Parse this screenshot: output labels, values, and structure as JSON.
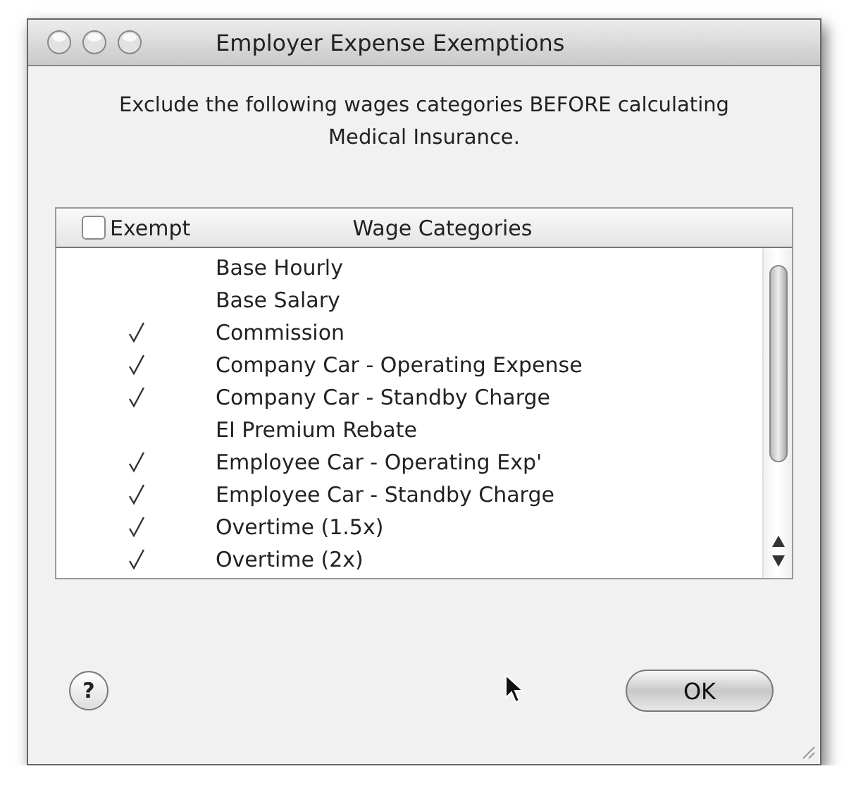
{
  "window": {
    "title": "Employer Expense Exemptions"
  },
  "message": "Exclude the following wages categories BEFORE calculating Medical Insurance.",
  "table": {
    "columns": [
      {
        "label": "Exempt",
        "kind": "checkbox",
        "checked": false
      },
      {
        "label": "Wage Categories",
        "kind": "text"
      }
    ],
    "rows": [
      {
        "name": "Base Hourly",
        "checked": false
      },
      {
        "name": "Base Salary",
        "checked": false
      },
      {
        "name": "Commission",
        "checked": true
      },
      {
        "name": "Company Car - Operating Expense",
        "checked": true
      },
      {
        "name": "Company Car - Standby Charge",
        "checked": true
      },
      {
        "name": "EI Premium Rebate",
        "checked": false
      },
      {
        "name": "Employee Car - Operating Exp'",
        "checked": true
      },
      {
        "name": "Employee Car - Standby Charge",
        "checked": true
      },
      {
        "name": "Overtime (1.5x)",
        "checked": true
      },
      {
        "name": "Overtime (2x)",
        "checked": true
      }
    ]
  },
  "help_button": "?",
  "buttons": [
    "OK"
  ]
}
